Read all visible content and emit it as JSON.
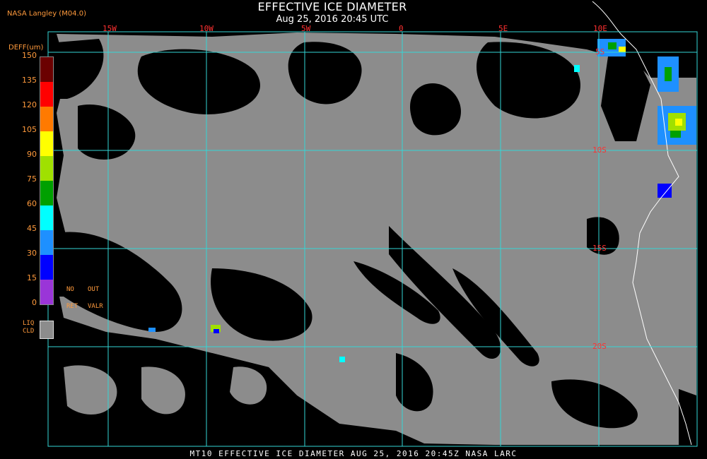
{
  "header": {
    "title": "EFFECTIVE ICE DIAMETER",
    "subtitle": "Aug 25, 2016 20:45 UTC",
    "source": "NASA Langley (M04.0)"
  },
  "map": {
    "lon_labels": [
      "15W",
      "10W",
      "5W",
      "0",
      "5E",
      "10E"
    ],
    "lat_labels": [
      "5S",
      "10S",
      "15S",
      "20S"
    ],
    "colors": {
      "background": "#000000",
      "cloud_gray": "#8c8c8c",
      "grid": "#33d6d6",
      "coast": "#ffffff",
      "label_red": "#ff3030",
      "label_orange": "#ff9a3c"
    }
  },
  "legend": {
    "unit": "DEFF(um)",
    "ticks": [
      "150",
      "135",
      "120",
      "105",
      "90",
      "75",
      "60",
      "45",
      "30",
      "15",
      "0"
    ],
    "colors": [
      "#6b0000",
      "#ff0000",
      "#ff7a00",
      "#ffff00",
      "#a0e000",
      "#00a000",
      "#00ffff",
      "#1e90ff",
      "#0000ff",
      "#9a35d8"
    ],
    "no_ret": [
      "NO",
      "RET"
    ],
    "out_valr": [
      "OUT",
      "VALR"
    ],
    "liq": "LIQ",
    "cld": "CLD"
  },
  "footer": "MT10  EFFECTIVE ICE DIAMETER  AUG 25, 2016 20:45Z  NASA LARC"
}
